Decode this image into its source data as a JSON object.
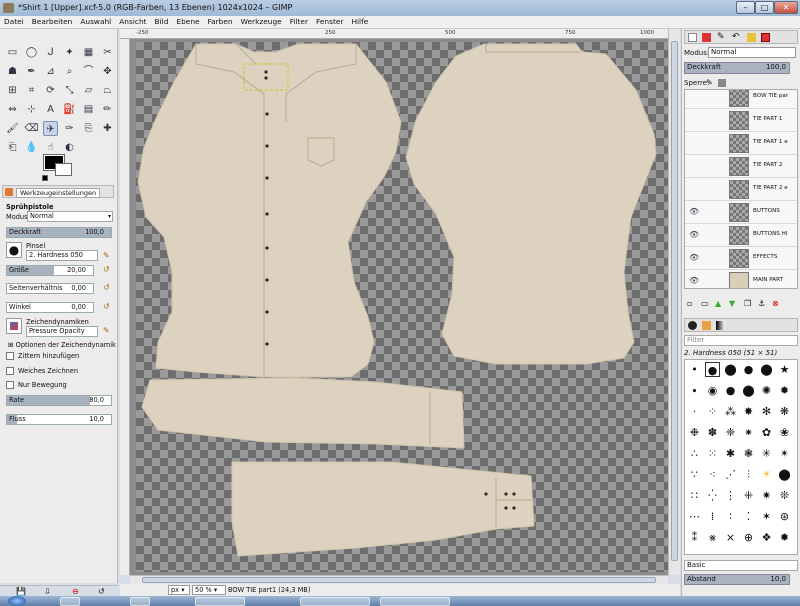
{
  "window": {
    "title": "*Shirt 1 [Upper].xcf-5.0 (RGB-Farben, 13 Ebenen) 1024x1024 – GIMP",
    "min": "–",
    "max": "□",
    "close": "✕"
  },
  "menu": [
    "Datei",
    "Bearbeiten",
    "Auswahl",
    "Ansicht",
    "Bild",
    "Ebene",
    "Farben",
    "Werkzeuge",
    "Filter",
    "Fenster",
    "Hilfe"
  ],
  "tool_options": {
    "tab_label": "Werkzeugeinstellungen",
    "tool_name": "Sprühpistole",
    "mode_label": "Modus:",
    "mode_value": "Normal",
    "opacity_label": "Deckkraft",
    "opacity_value": "100,0",
    "brush_label": "Pinsel",
    "brush_value": "2. Hardness 050",
    "size_label": "Größe",
    "size_value": "20,00",
    "aspect_label": "Seitenverhältnis",
    "aspect_value": "0,00",
    "angle_label": "Winkel",
    "angle_value": "0,00",
    "dynamics_label": "Zeichendynamiken",
    "dynamics_value": "Pressure Opacity",
    "dynamics_options": "Optionen der Zeichendynamik",
    "jitter": "Zittern hinzufügen",
    "smooth": "Weiches Zeichnen",
    "incremental": "Nur Bewegung",
    "rate_label": "Rate",
    "rate_value": "80,0",
    "rate_fraction": 0.8,
    "flow_label": "Fluss",
    "flow_value": "10,0",
    "flow_fraction": 0.1,
    "opacity_fraction": 1.0,
    "size_fraction": 0.55
  },
  "ruler": {
    "ticks": [
      "-250",
      "",
      "250",
      "",
      "500",
      "",
      "750",
      "1000"
    ]
  },
  "status": {
    "unit": "px",
    "zoom": "50 %",
    "layer_info": "BOW TIE part1 (24,3 MB)"
  },
  "layers_panel": {
    "mode_label": "Modus:",
    "mode_value": "Normal",
    "opacity_label": "Deckkraft",
    "opacity_value": "100,0",
    "lock_label": "Sperre:",
    "layers": [
      {
        "name": "BOW TIE par",
        "visible": false
      },
      {
        "name": "TIE PART 1",
        "visible": false
      },
      {
        "name": "TIE PART 1 e",
        "visible": false
      },
      {
        "name": "TIE PART 2",
        "visible": false
      },
      {
        "name": "TIE PART 2 e",
        "visible": false
      },
      {
        "name": "BUTTONS",
        "visible": true
      },
      {
        "name": "BUTTONS HI",
        "visible": true
      },
      {
        "name": "EFFECTS",
        "visible": true
      },
      {
        "name": "MAIN PART",
        "visible": true
      }
    ]
  },
  "brushes_panel": {
    "filter_placeholder": "Filter",
    "current": "2. Hardness 050 (51 × 51)",
    "preset": "Basic",
    "spacing_label": "Abstand",
    "spacing_value": "10,0"
  },
  "taskbar": {
    "items": [
      "",
      "",
      "",
      "",
      ""
    ]
  },
  "colors": {
    "skin": "#dcd2bf",
    "accent": "#7a92b8"
  }
}
